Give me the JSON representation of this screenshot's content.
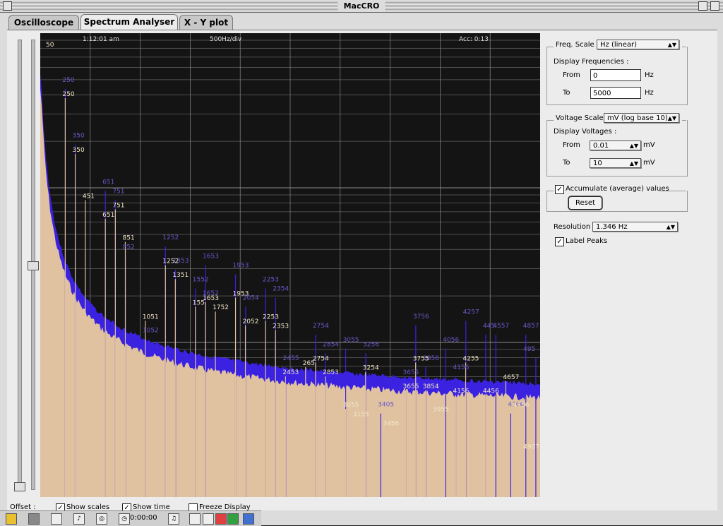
{
  "window": {
    "title": "MacCRO"
  },
  "tabs": [
    {
      "label": "Oscilloscope",
      "active": false
    },
    {
      "label": "Spectrum Analyser",
      "active": true
    },
    {
      "label": "X - Y plot",
      "active": false
    }
  ],
  "plot": {
    "time": "1:12:01 am",
    "scale_readout": "500Hz/div",
    "acc_readout": "Acc: 0:13",
    "colors": {
      "background": "#141414",
      "grid": "#8a8a8a",
      "average": "#3a22e0",
      "current": "#e0c2a0",
      "label_current": "#f2e6c8",
      "label_average": "#6a58c8"
    },
    "x_range_hz": [
      0,
      5000
    ],
    "first_peak_label": "50",
    "peaks_current": [
      {
        "label": "250",
        "freq": 250,
        "level": 0.86
      },
      {
        "label": "350",
        "freq": 350,
        "level": 0.74
      },
      {
        "label": "451",
        "freq": 451,
        "level": 0.64
      },
      {
        "label": "651",
        "freq": 651,
        "level": 0.6
      },
      {
        "label": "751",
        "freq": 751,
        "level": 0.62
      },
      {
        "label": "851",
        "freq": 851,
        "level": 0.55
      },
      {
        "label": "1051",
        "freq": 1051,
        "level": 0.38
      },
      {
        "label": "1252",
        "freq": 1252,
        "level": 0.5
      },
      {
        "label": "1351",
        "freq": 1351,
        "level": 0.47
      },
      {
        "label": "155",
        "freq": 1552,
        "level": 0.41
      },
      {
        "label": "1653",
        "freq": 1653,
        "level": 0.42
      },
      {
        "label": "1752",
        "freq": 1752,
        "level": 0.4
      },
      {
        "label": "1953",
        "freq": 1953,
        "level": 0.43
      },
      {
        "label": "2052",
        "freq": 2052,
        "level": 0.37
      },
      {
        "label": "2253",
        "freq": 2253,
        "level": 0.38
      },
      {
        "label": "2353",
        "freq": 2353,
        "level": 0.36
      },
      {
        "label": "2453",
        "freq": 2453,
        "level": 0.26
      },
      {
        "label": "265",
        "freq": 2654,
        "level": 0.28
      },
      {
        "label": "2754",
        "freq": 2754,
        "level": 0.29
      },
      {
        "label": "2853",
        "freq": 2853,
        "level": 0.26
      },
      {
        "label": "3055",
        "freq": 3055,
        "level": 0.19
      },
      {
        "label": "3155",
        "freq": 3155,
        "level": 0.17
      },
      {
        "label": "3254",
        "freq": 3254,
        "level": 0.27
      },
      {
        "label": "3456",
        "freq": 3456,
        "level": 0.15
      },
      {
        "label": "3655",
        "freq": 3655,
        "level": 0.23
      },
      {
        "label": "3755",
        "freq": 3755,
        "level": 0.29
      },
      {
        "label": "3854",
        "freq": 3854,
        "level": 0.23
      },
      {
        "label": "3955",
        "freq": 3955,
        "level": 0.18
      },
      {
        "label": "4156",
        "freq": 4156,
        "level": 0.22
      },
      {
        "label": "4255",
        "freq": 4255,
        "level": 0.29
      },
      {
        "label": "4456",
        "freq": 4456,
        "level": 0.22
      },
      {
        "label": "4657",
        "freq": 4657,
        "level": 0.25
      },
      {
        "label": "4756",
        "freq": 4756,
        "level": 0.19
      },
      {
        "label": "4907",
        "freq": 4907,
        "level": 0.1
      }
    ],
    "peaks_average": [
      {
        "label": "250",
        "freq": 250,
        "level": 0.88
      },
      {
        "label": "350",
        "freq": 350,
        "level": 0.76
      },
      {
        "label": "651",
        "freq": 651,
        "level": 0.66
      },
      {
        "label": "751",
        "freq": 751,
        "level": 0.64
      },
      {
        "label": "852",
        "freq": 852,
        "level": 0.52
      },
      {
        "label": "1052",
        "freq": 1052,
        "level": 0.34
      },
      {
        "label": "1252",
        "freq": 1252,
        "level": 0.54
      },
      {
        "label": "1353",
        "freq": 1353,
        "level": 0.49
      },
      {
        "label": "1552",
        "freq": 1552,
        "level": 0.45
      },
      {
        "label": "1652",
        "freq": 1652,
        "level": 0.42
      },
      {
        "label": "1653",
        "freq": 1653,
        "level": 0.5
      },
      {
        "label": "1953",
        "freq": 1953,
        "level": 0.48
      },
      {
        "label": "2054",
        "freq": 2054,
        "level": 0.41
      },
      {
        "label": "2253",
        "freq": 2253,
        "level": 0.45
      },
      {
        "label": "2354",
        "freq": 2354,
        "level": 0.43
      },
      {
        "label": "2455",
        "freq": 2455,
        "level": 0.28
      },
      {
        "label": "2754",
        "freq": 2754,
        "level": 0.35
      },
      {
        "label": "2854",
        "freq": 2854,
        "level": 0.31
      },
      {
        "label": "3055",
        "freq": 3055,
        "level": 0.32
      },
      {
        "label": "3256",
        "freq": 3256,
        "level": 0.31
      },
      {
        "label": "3405",
        "freq": 3405,
        "level": 0.18
      },
      {
        "label": "3655",
        "freq": 3655,
        "level": 0.25
      },
      {
        "label": "3756",
        "freq": 3756,
        "level": 0.37
      },
      {
        "label": "3856",
        "freq": 3856,
        "level": 0.28
      },
      {
        "label": "4056",
        "freq": 4056,
        "level": 0.32
      },
      {
        "label": "4156",
        "freq": 4156,
        "level": 0.26
      },
      {
        "label": "4257",
        "freq": 4257,
        "level": 0.38
      },
      {
        "label": "445",
        "freq": 4456,
        "level": 0.35
      },
      {
        "label": "4557",
        "freq": 4557,
        "level": 0.35
      },
      {
        "label": "4706",
        "freq": 4706,
        "level": 0.18
      },
      {
        "label": "4857",
        "freq": 4857,
        "level": 0.35
      },
      {
        "label": "495",
        "freq": 4957,
        "level": 0.3
      }
    ]
  },
  "freq": {
    "scale_label": "Freq. Scale :",
    "scale_value": "Hz (linear)",
    "display_label": "Display Frequencies :",
    "from_label": "From",
    "from_value": "0",
    "to_label": "To",
    "to_value": "5000",
    "unit": "Hz"
  },
  "voltage": {
    "scale_label": "Voltage Scale :",
    "scale_value": "mV (log base 10)",
    "display_label": "Display Voltages :",
    "from_label": "From",
    "from_value": "0.01",
    "to_label": "To",
    "to_value": "10",
    "unit": "mV"
  },
  "accumulate": {
    "label": "Accumulate (average) values",
    "checked": true,
    "reset_label": "Reset"
  },
  "resolution": {
    "label": "Resolution :",
    "value": "1.346 Hz"
  },
  "label_peaks": {
    "label": "Label Peaks",
    "checked": true
  },
  "bottom": {
    "offset_label": "Offset :",
    "show_scales": "Show scales",
    "show_time": "Show time",
    "freeze": "Freeze Display"
  },
  "taskbar": {
    "clock": "0:00:00"
  }
}
